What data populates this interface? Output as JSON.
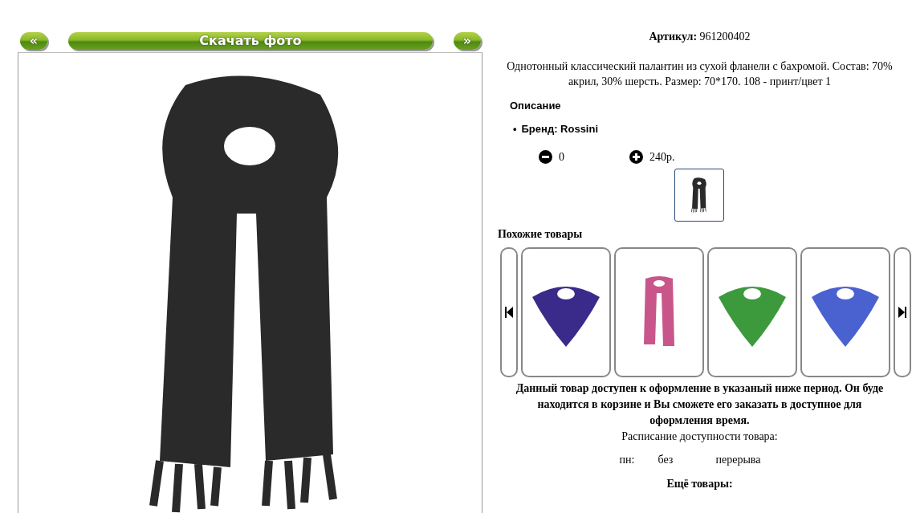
{
  "gallery": {
    "prev": "«",
    "download": "Скачать фото",
    "next": "»"
  },
  "product": {
    "article_label": "Артикул:",
    "article": "961200402",
    "description": "Однотонный классический палантин из сухой фланели с бахромой. Состав: 70% акрил, 30% шерсть. Размер: 70*170. 108 - принт/цвет 1",
    "details_title": "Описание",
    "details": [
      {
        "bullet": "•",
        "text": "Бренд: Rossini"
      }
    ],
    "quantity": "0",
    "price": "240р.",
    "thumbnails": [
      {
        "selected": true
      }
    ]
  },
  "similar": {
    "title": "Похожие товары",
    "items": [
      {
        "kind": "square",
        "color": "#3a2a8a"
      },
      {
        "kind": "long",
        "color": "#c8568a"
      },
      {
        "kind": "square",
        "color": "#3c9a3c"
      },
      {
        "kind": "square",
        "color": "#4a62d0"
      }
    ]
  },
  "availability": {
    "notice": [
      "Данный товар доступен к оформление в указаный ниже период. Он буде",
      "находится в корзине и Вы сможете его заказать в доступное для",
      "оформления время."
    ],
    "schedule_title": "Расписание доступности товара:",
    "schedule": [
      {
        "day": "пн:",
        "from": "без",
        "to": "перерыва"
      }
    ]
  },
  "more": {
    "title": "Ещё товары:"
  }
}
